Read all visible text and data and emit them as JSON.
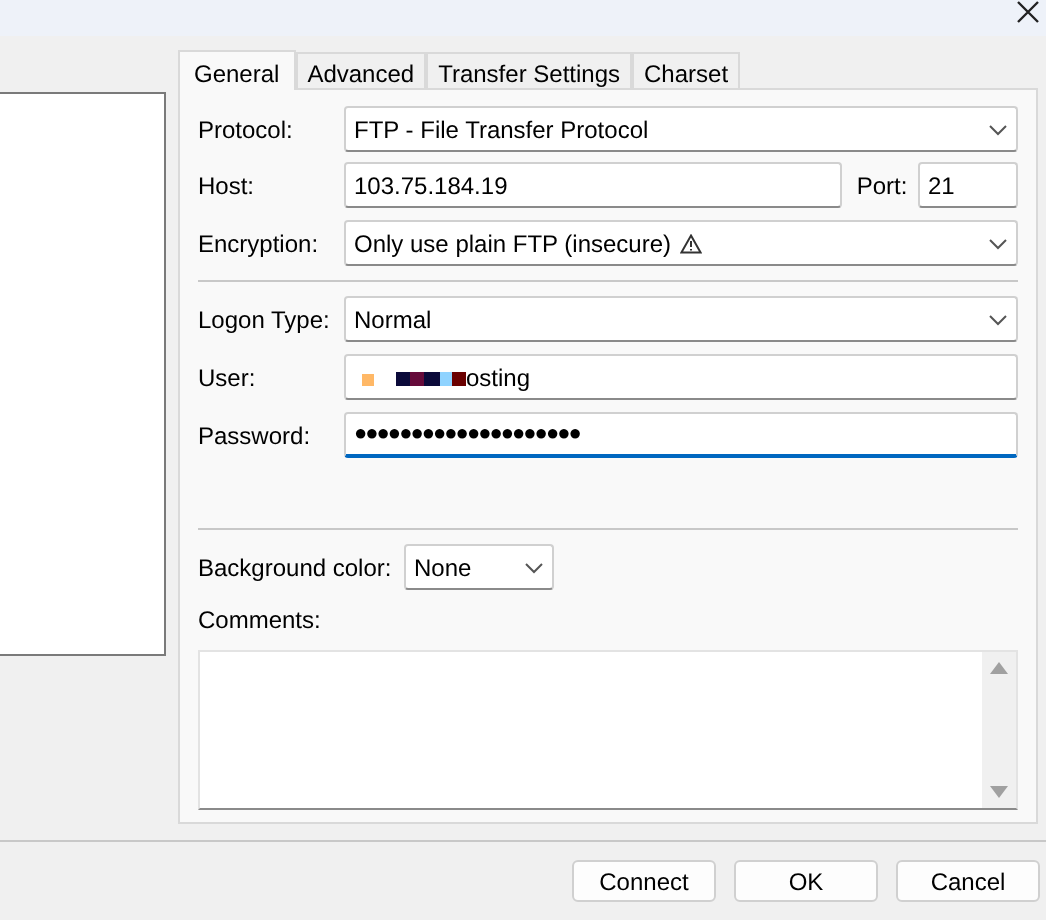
{
  "tabs": [
    {
      "label": "General",
      "selected": true
    },
    {
      "label": "Advanced",
      "selected": false
    },
    {
      "label": "Transfer Settings",
      "selected": false
    },
    {
      "label": "Charset",
      "selected": false
    }
  ],
  "protocol": {
    "label": "Protocol:",
    "value": "FTP - File Transfer Protocol"
  },
  "host": {
    "label": "Host:",
    "value": "103.75.184.19"
  },
  "port": {
    "label": "Port:",
    "value": "21"
  },
  "encryption": {
    "label": "Encryption:",
    "value": "Only use plain FTP (insecure)",
    "warning": true
  },
  "logon_type": {
    "label": "Logon Type:",
    "value": "Normal"
  },
  "user": {
    "label": "User:",
    "value": "osting",
    "redacted": true
  },
  "password": {
    "label": "Password:",
    "value": "●●●●●●●●●●●●●●●●●●●●",
    "focused": true
  },
  "background_color": {
    "label": "Background color:",
    "value": "None"
  },
  "comments": {
    "label": "Comments:"
  },
  "buttons": [
    "Connect",
    "OK",
    "Cancel"
  ]
}
